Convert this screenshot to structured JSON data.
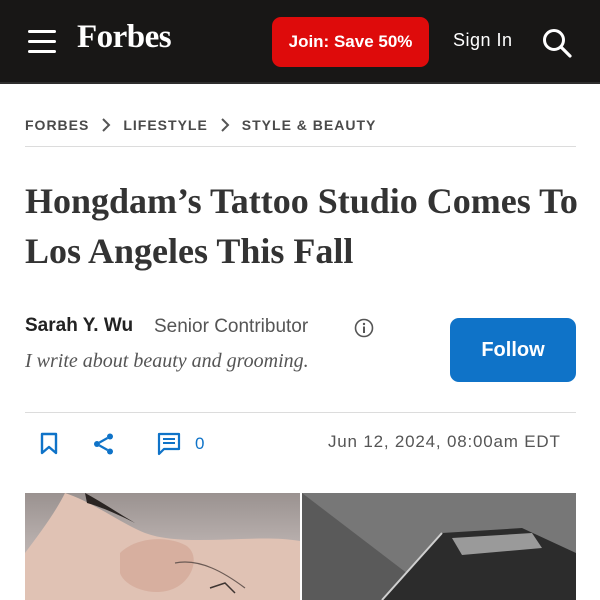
{
  "header": {
    "logo": "Forbes",
    "join_label": "Join: Save 50%",
    "sign_in_label": "Sign In",
    "icons": [
      "menu-icon",
      "search-icon"
    ],
    "background": "#181716",
    "join_color": "#de0b0b"
  },
  "breadcrumb": {
    "items": [
      "FORBES",
      "LIFESTYLE",
      "STYLE & BEAUTY"
    ]
  },
  "article": {
    "title": "Hongdam’s Tattoo Studio Comes To Los Angeles This Fall",
    "author": {
      "name": "Sarah Y. Wu",
      "role": "Senior Contributor",
      "bio": "I write about beauty and grooming.",
      "follow_label": "Follow",
      "follow_color": "#0f73c8"
    },
    "actions": {
      "icons": [
        "bookmark-icon",
        "share-icon",
        "comment-icon"
      ],
      "comment_count": "0",
      "date": "Jun 12, 2024, 08:00am EDT"
    },
    "images": [
      "shoulder-tattoo-photo",
      "studio-interior-photo"
    ]
  }
}
